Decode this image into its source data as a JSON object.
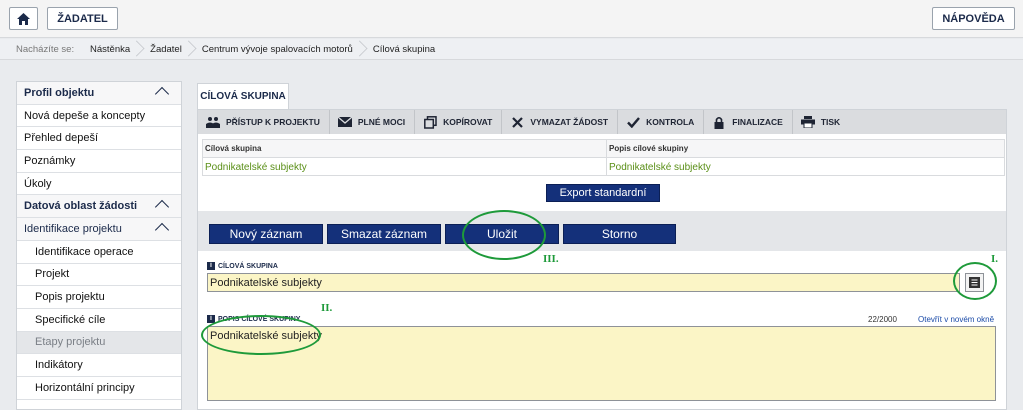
{
  "topbar": {
    "home_icon": "home-icon",
    "zadatel_label": "ŽADATEL",
    "napoveda_label": "NÁPOVĚDA"
  },
  "breadcrumb": {
    "prefix": "Nacházíte se:",
    "items": [
      "Nástěnka",
      "Žadatel",
      "Centrum vývoje spalovacích motorů",
      "Cílová skupina"
    ]
  },
  "sidebar": {
    "items": [
      {
        "label": "Profil objektu",
        "type": "section"
      },
      {
        "label": "Nová depeše a koncepty",
        "type": "item"
      },
      {
        "label": "Přehled depeší",
        "type": "item"
      },
      {
        "label": "Poznámky",
        "type": "item"
      },
      {
        "label": "Úkoly",
        "type": "item"
      },
      {
        "label": "Datová oblast žádosti",
        "type": "section"
      },
      {
        "label": "Identifikace projektu",
        "type": "section-sub"
      },
      {
        "label": "Identifikace operace",
        "type": "sub"
      },
      {
        "label": "Projekt",
        "type": "sub"
      },
      {
        "label": "Popis projektu",
        "type": "sub"
      },
      {
        "label": "Specifické cíle",
        "type": "sub"
      },
      {
        "label": "Etapy projektu",
        "type": "sub-active"
      },
      {
        "label": "Indikátory",
        "type": "sub"
      },
      {
        "label": "Horizontální principy",
        "type": "sub"
      }
    ]
  },
  "tab": {
    "label": "CÍLOVÁ SKUPINA"
  },
  "toolbar": {
    "items": [
      {
        "label": "PŘÍSTUP K PROJEKTU",
        "icon": "people-icon"
      },
      {
        "label": "PLNÉ MOCI",
        "icon": "envelope-icon"
      },
      {
        "label": "KOPÍROVAT",
        "icon": "copy-icon"
      },
      {
        "label": "VYMAZAT ŽÁDOST",
        "icon": "close-icon"
      },
      {
        "label": "KONTROLA",
        "icon": "check-icon"
      },
      {
        "label": "FINALIZACE",
        "icon": "lock-icon"
      },
      {
        "label": "TISK",
        "icon": "printer-icon"
      }
    ]
  },
  "grid": {
    "columns": [
      "Cílová skupina",
      "Popis cílové skupiny"
    ],
    "rows": [
      [
        "Podnikatelské subjekty",
        "Podnikatelské subjekty"
      ]
    ]
  },
  "export_label": "Export standardní",
  "actions": {
    "new": "Nový záznam",
    "delete": "Smazat záznam",
    "save": "Uložit",
    "cancel": "Storno"
  },
  "form": {
    "cilova_label": "CÍLOVÁ SKUPINA",
    "cilova_value": "Podnikatelské subjekty",
    "popis_label": "POPIS CÍLOVÉ SKUPINY",
    "popis_value": "Podnikatelské subjekty",
    "counter": "22/2000",
    "open_link": "Otevřít v novém okně"
  },
  "annotations": {
    "i": "I.",
    "ii": "II.",
    "iii": "III.",
    "color": "#1e9a3a"
  }
}
